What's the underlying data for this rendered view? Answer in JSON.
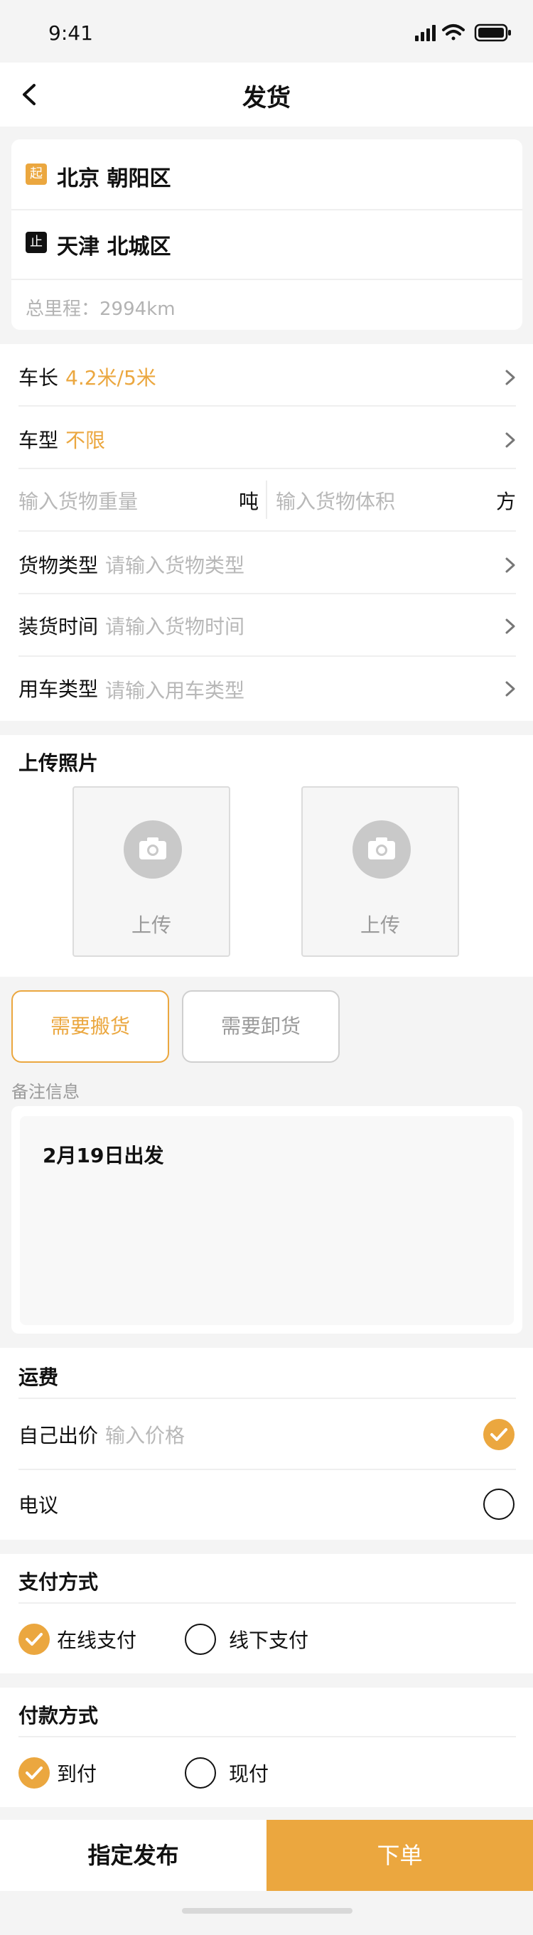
{
  "status_bar": {
    "time": "9:41"
  },
  "navbar": {
    "title": "发货"
  },
  "route": {
    "start_tag": "起",
    "start": "北京 朝阳区",
    "end_tag": "止",
    "end": "天津 北城区",
    "mileage": "总里程：2994km"
  },
  "form": {
    "length_label": "车长",
    "length_value": "4.2米/5米",
    "type_label": "车型",
    "type_value": "不限",
    "weight_placeholder": "输入货物重量",
    "weight_unit": "吨",
    "volume_placeholder": "输入货物体积",
    "volume_unit": "方",
    "cargo_label": "货物类型",
    "cargo_placeholder": "请输入货物类型",
    "load_label": "装货时间",
    "load_placeholder": "请输入货物时间",
    "use_label": "用车类型",
    "use_placeholder": "请输入用车类型"
  },
  "photos": {
    "title": "上传照片",
    "upload_label_1": "上传",
    "upload_label_2": "上传"
  },
  "services": {
    "carry": "需要搬货",
    "unload": "需要卸货"
  },
  "remark": {
    "label": "备注信息",
    "text": "2月19日出发"
  },
  "freight": {
    "title": "运费",
    "self_label": "自己出价",
    "self_placeholder": "输入价格",
    "negotiate_label": "电议"
  },
  "payment_method": {
    "title": "支付方式",
    "online": "在线支付",
    "offline": "线下支付"
  },
  "settlement": {
    "title": "付款方式",
    "on_arrival": "到付",
    "cash": "现付"
  },
  "bottom": {
    "assign": "指定发布",
    "order": "下单"
  },
  "colors": {
    "accent": "#eba73f",
    "text": "#111111",
    "placeholder": "#b8b8b8",
    "background": "#f4f4f4"
  }
}
